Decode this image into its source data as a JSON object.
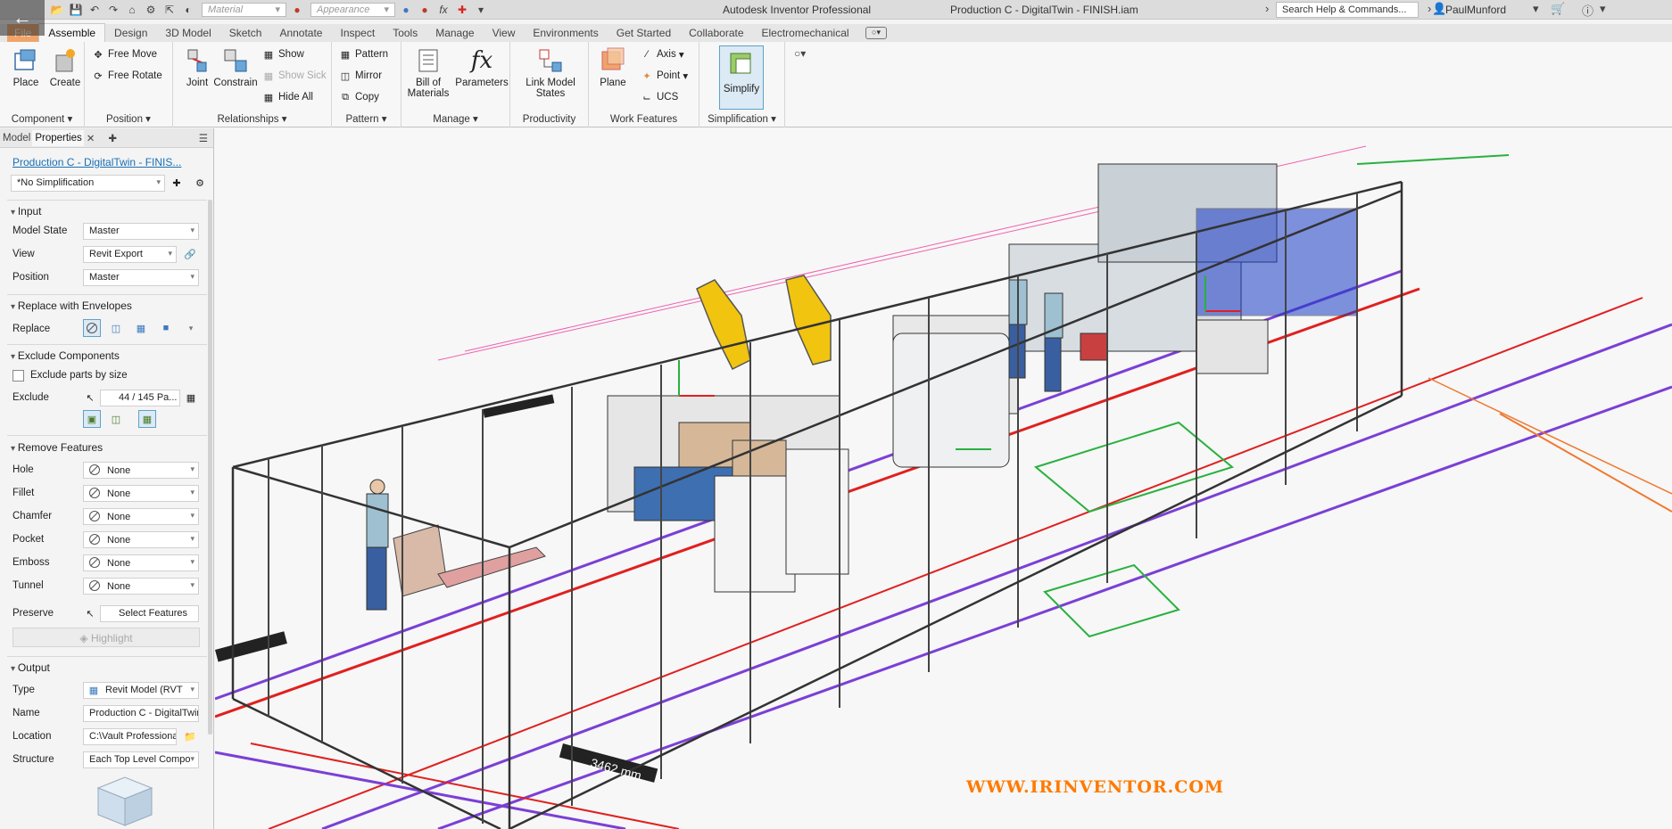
{
  "titlebar": {
    "app_title": "Autodesk Inventor Professional",
    "doc_title": "Production C - DigitalTwin - FINISH.iam",
    "material_placeholder": "Material",
    "appearance_placeholder": "Appearance",
    "fx_label": "fx",
    "search_placeholder": "Search Help & Commands...",
    "user": "PaulMunford"
  },
  "tabs": [
    "File",
    "Assemble",
    "Design",
    "3D Model",
    "Sketch",
    "Annotate",
    "Inspect",
    "Tools",
    "Manage",
    "View",
    "Environments",
    "Get Started",
    "Collaborate",
    "Electromechanical"
  ],
  "active_tab": "Assemble",
  "ribbon": {
    "component": {
      "label": "Component",
      "place": "Place",
      "create": "Create"
    },
    "position": {
      "label": "Position",
      "free_move": "Free Move",
      "free_rotate": "Free Rotate"
    },
    "relationships": {
      "label": "Relationships",
      "joint": "Joint",
      "constrain": "Constrain",
      "show": "Show",
      "show_sick": "Show Sick",
      "hide_all": "Hide All"
    },
    "pattern": {
      "label": "Pattern",
      "pattern": "Pattern",
      "mirror": "Mirror",
      "copy": "Copy"
    },
    "manage": {
      "label": "Manage",
      "bom_line1": "Bill of",
      "bom_line2": "Materials",
      "parameters": "Parameters",
      "fx": "fx"
    },
    "productivity": {
      "label": "Productivity",
      "link_line1": "Link Model",
      "link_line2": "States"
    },
    "work_features": {
      "label": "Work Features",
      "plane": "Plane",
      "axis": "Axis",
      "point": "Point",
      "ucs": "UCS"
    },
    "simplification": {
      "label": "Simplification",
      "simplify": "Simplify"
    }
  },
  "left_panel": {
    "tab_model": "Model",
    "tab_properties": "Properties",
    "document_link": "Production C - DigitalTwin - FINIS...",
    "simplification_select": "*No Simplification",
    "input": {
      "heading": "Input",
      "model_state_label": "Model State",
      "model_state": "Master",
      "view_label": "View",
      "view": "Revit Export",
      "position_label": "Position",
      "position": "Master"
    },
    "envelopes": {
      "heading": "Replace with Envelopes",
      "replace_label": "Replace"
    },
    "exclude": {
      "heading": "Exclude Components",
      "exclude_by_size": "Exclude parts by size",
      "exclude_label": "Exclude",
      "exclude_value": "44 / 145 Pa..."
    },
    "remove_features": {
      "heading": "Remove Features",
      "rows": [
        {
          "label": "Hole",
          "value": "None"
        },
        {
          "label": "Fillet",
          "value": "None"
        },
        {
          "label": "Chamfer",
          "value": "None"
        },
        {
          "label": "Pocket",
          "value": "None"
        },
        {
          "label": "Emboss",
          "value": "None"
        },
        {
          "label": "Tunnel",
          "value": "None"
        }
      ],
      "preserve_label": "Preserve",
      "preserve_value": "Select Features",
      "highlight": "Highlight"
    },
    "output": {
      "heading": "Output",
      "type_label": "Type",
      "type": "Revit Model (RVT",
      "name_label": "Name",
      "name": "Production C - DigitalTwin",
      "location_label": "Location",
      "location": "C:\\Vault Professional",
      "structure_label": "Structure",
      "structure": "Each Top Level Compo"
    }
  },
  "viewport": {
    "watermark": "WWW.IRINVENTOR.COM",
    "measurement": "3462 mm"
  }
}
